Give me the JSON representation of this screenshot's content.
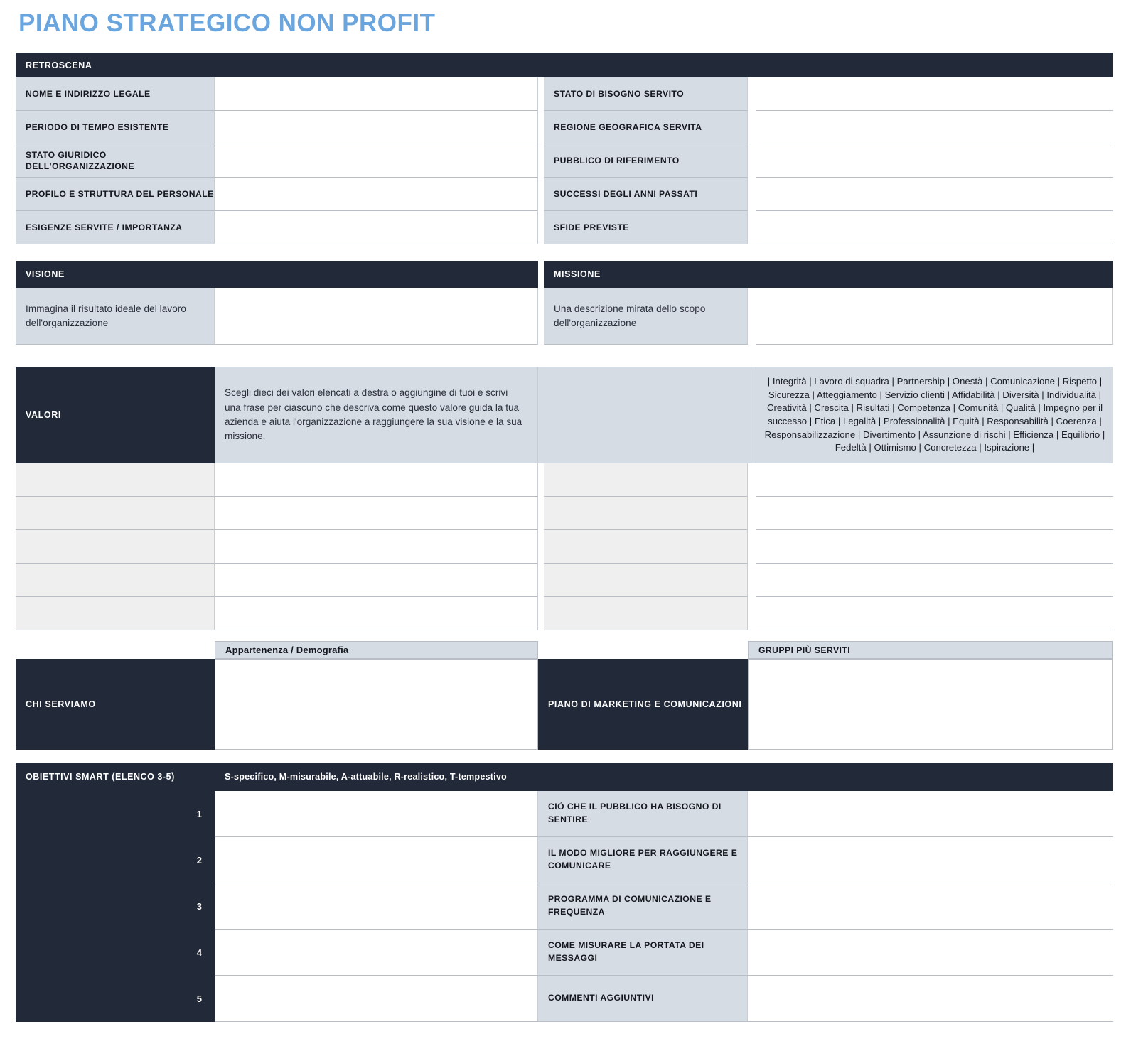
{
  "title": "PIANO STRATEGICO NON PROFIT",
  "colors": {
    "title": "#6aa5dd",
    "dark_header": "#222938",
    "label_fill": "#d6dce4",
    "blank_label_fill": "#efefef",
    "border": "#b9bec6"
  },
  "retroscena": {
    "header": "RETROSCENA",
    "rows": [
      {
        "left_label": "NOME E INDIRIZZO LEGALE",
        "left_value": "",
        "right_label": "STATO DI BISOGNO SERVITO",
        "right_value": ""
      },
      {
        "left_label": "PERIODO DI TEMPO ESISTENTE",
        "left_value": "",
        "right_label": "REGIONE GEOGRAFICA SERVITA",
        "right_value": ""
      },
      {
        "left_label": "STATO GIURIDICO DELL'ORGANIZZAZIONE",
        "left_value": "",
        "right_label": "PUBBLICO DI RIFERIMENTO",
        "right_value": ""
      },
      {
        "left_label": "PROFILO E STRUTTURA DEL PERSONALE",
        "left_value": "",
        "right_label": "SUCCESSI DEGLI ANNI PASSATI",
        "right_value": ""
      },
      {
        "left_label": "ESIGENZE SERVITE / IMPORTANZA",
        "left_value": "",
        "right_label": "SFIDE PREVISTE",
        "right_value": ""
      }
    ]
  },
  "visione_missione": {
    "visione_header": "VISIONE",
    "missione_header": "MISSIONE",
    "visione_desc": "Immagina il risultato ideale del lavoro dell'organizzazione",
    "missione_desc": "Una descrizione mirata dello scopo dell'organizzazione",
    "visione_value": "",
    "missione_value": ""
  },
  "valori": {
    "header": "VALORI",
    "instructions": "Scegli dieci dei valori elencati a destra o aggiungine di tuoi e scrivi una frase per ciascuno che descriva come questo valore guida la tua azienda e aiuta l'organizzazione a raggiungere la sua visione e la sua missione.",
    "values_list": "| Integrità | Lavoro di squadra | Partnership | Onestà | Comunicazione | Rispetto | Sicurezza | Atteggiamento | Servizio clienti | Affidabilità | Diversità | Individualità | Creatività | Crescita | Risultati | Competenza | Comunità | Qualità | Impegno per il successo | Etica | Legalità | Professionalità | Equità | Responsabilità | Coerenza | Responsabilizzazione | Divertimento | Assunzione di rischi | Efficienza | Equilibrio | Fedeltà | Ottimismo | Concretezza | Ispirazione |",
    "values_items": [
      "Integrità",
      "Lavoro di squadra",
      "Partnership",
      "Onestà",
      "Comunicazione",
      "Rispetto",
      "Sicurezza",
      "Atteggiamento",
      "Servizio clienti",
      "Affidabilità",
      "Diversità",
      "Individualità",
      "Creatività",
      "Crescita",
      "Risultati",
      "Competenza",
      "Comunità",
      "Qualità",
      "Impegno per il successo",
      "Etica",
      "Legalità",
      "Professionalità",
      "Equità",
      "Responsabilità",
      "Coerenza",
      "Responsabilizzazione",
      "Divertimento",
      "Assunzione di rischi",
      "Efficienza",
      "Equilibrio",
      "Fedeltà",
      "Ottimismo",
      "Concretezza",
      "Ispirazione"
    ],
    "blank_rows": [
      {
        "label": "",
        "value": "",
        "label2": "",
        "value2": ""
      },
      {
        "label": "",
        "value": "",
        "label2": "",
        "value2": ""
      },
      {
        "label": "",
        "value": "",
        "label2": "",
        "value2": ""
      },
      {
        "label": "",
        "value": "",
        "label2": "",
        "value2": ""
      },
      {
        "label": "",
        "value": "",
        "label2": "",
        "value2": ""
      }
    ]
  },
  "chi_serviamo": {
    "left_header": "CHI SERVIAMO",
    "right_header": "PIANO DI MARKETING E COMUNICAZIONI",
    "sub_header_left": "Appartenenza / Demografia",
    "sub_header_right": "GRUPPI PIÙ SERVITI",
    "left_value": "",
    "right_value": ""
  },
  "obiettivi_smart": {
    "header": "OBIETTIVI SMART (ELENCO 3-5)",
    "subtitle": "S-specifico, M-misurabile, A-attuabile, R-realistico, T-tempestivo",
    "rows": [
      {
        "num": "1",
        "goal": "",
        "label": "CIÒ CHE IL PUBBLICO HA BISOGNO DI SENTIRE",
        "value": ""
      },
      {
        "num": "2",
        "goal": "",
        "label": "IL MODO MIGLIORE PER RAGGIUNGERE E COMUNICARE",
        "value": ""
      },
      {
        "num": "3",
        "goal": "",
        "label": "PROGRAMMA DI COMUNICAZIONE E FREQUENZA",
        "value": ""
      },
      {
        "num": "4",
        "goal": "",
        "label": "COME MISURARE LA PORTATA DEI MESSAGGI",
        "value": ""
      },
      {
        "num": "5",
        "goal": "",
        "label": "COMMENTI AGGIUNTIVI",
        "value": ""
      }
    ]
  }
}
